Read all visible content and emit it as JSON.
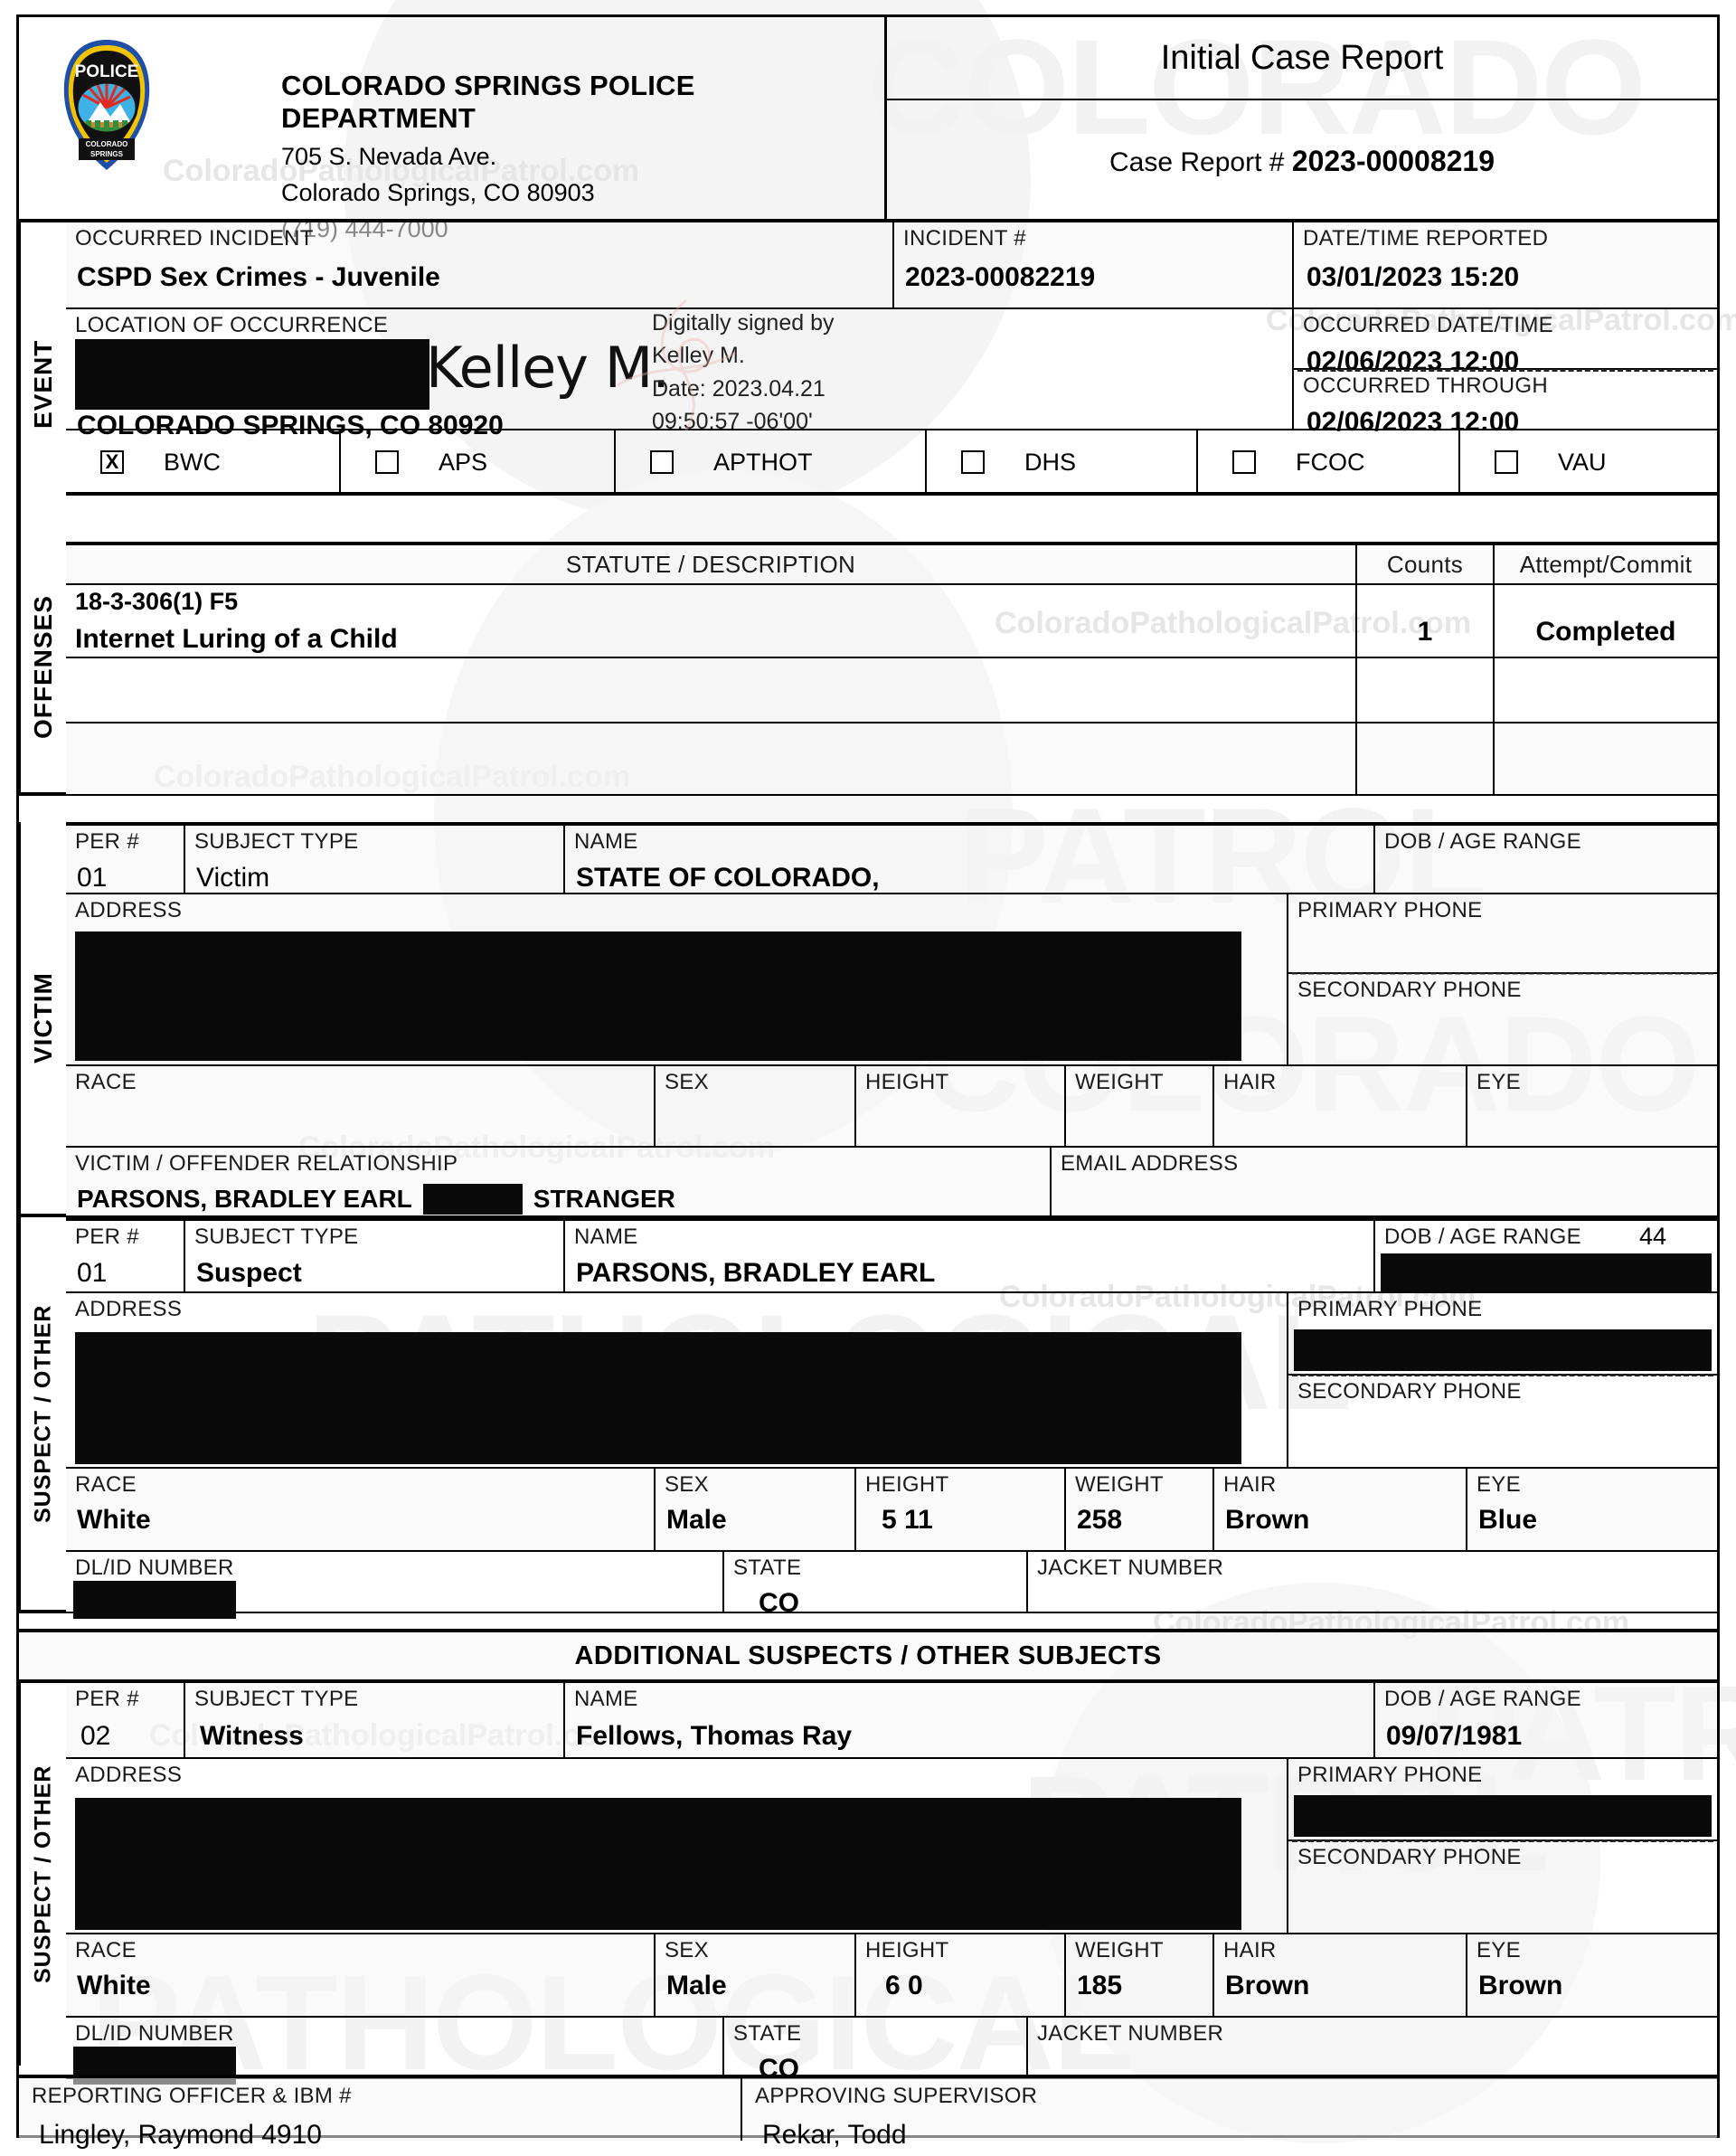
{
  "document": {
    "title": "Initial Case Report",
    "case_report_label": "Case Report #",
    "case_report_number": "2023-00008219"
  },
  "agency": {
    "name": "COLORADO SPRINGS POLICE DEPARTMENT",
    "address_street": "705 S. Nevada Ave.",
    "address_city": "Colorado Springs, CO 80903",
    "phone": "(719) 444-7000",
    "badge_word_top": "POLICE",
    "badge_word_bottom_1": "COLORADO",
    "badge_word_bottom_2": "SPRINGS"
  },
  "event": {
    "section_label": "EVENT",
    "occurred_incident_label": "OCCURRED INCIDENT",
    "occurred_incident_value": "CSPD Sex Crimes - Juvenile",
    "incident_number_label": "INCIDENT #",
    "incident_number_value": "2023-00082219",
    "datetime_reported_label": "DATE/TIME REPORTED",
    "datetime_reported_value": "03/01/2023  15:20",
    "location_label": "LOCATION OF OCCURRENCE",
    "location_redacted": true,
    "location_city": "COLORADO SPRINGS, CO 80920",
    "occurred_datetime_label": "OCCURRED DATE/TIME",
    "occurred_datetime_value": "02/06/2023  12:00",
    "occurred_through_label": "OCCURRED THROUGH",
    "occurred_through_value": "02/06/2023  12:00"
  },
  "signature": {
    "name": "Kelley M.",
    "signed_by_line1": "Digitally signed by",
    "signed_by_line2": "Kelley M.",
    "date_line": "Date: 2023.04.21",
    "time_line": "09:50:57 -06'00'"
  },
  "checkboxes": [
    {
      "label": "BWC",
      "checked": true,
      "mark": "X"
    },
    {
      "label": "APS",
      "checked": false,
      "mark": ""
    },
    {
      "label": "APTHOT",
      "checked": false,
      "mark": ""
    },
    {
      "label": "DHS",
      "checked": false,
      "mark": ""
    },
    {
      "label": "FCOC",
      "checked": false,
      "mark": ""
    },
    {
      "label": "VAU",
      "checked": false,
      "mark": ""
    }
  ],
  "offenses": {
    "section_label": "OFFENSES",
    "col_statute": "STATUTE / DESCRIPTION",
    "col_counts": "Counts",
    "col_attempt": "Attempt/Commit",
    "rows": [
      {
        "statute": "18-3-306(1) F5",
        "description": "Internet Luring of a Child",
        "counts": "1",
        "attempt_commit": "Completed"
      },
      {
        "statute": "",
        "description": "",
        "counts": "",
        "attempt_commit": ""
      },
      {
        "statute": "",
        "description": "",
        "counts": "",
        "attempt_commit": ""
      }
    ]
  },
  "victim": {
    "section_label": "VICTIM",
    "per_label": "PER #",
    "per_value": "01",
    "subject_type_label": "SUBJECT TYPE",
    "subject_type_value": "Victim",
    "name_label": "NAME",
    "name_value": "STATE OF COLORADO,",
    "dob_label": "DOB / AGE RANGE",
    "dob_value": "",
    "address_label": "ADDRESS",
    "address_redacted": true,
    "primary_phone_label": "PRIMARY PHONE",
    "primary_phone_value": "",
    "secondary_phone_label": "SECONDARY PHONE",
    "secondary_phone_value": "",
    "race_label": "RACE",
    "race_value": "",
    "sex_label": "SEX",
    "sex_value": "",
    "height_label": "HEIGHT",
    "height_value": "",
    "weight_label": "WEIGHT",
    "weight_value": "",
    "hair_label": "HAIR",
    "hair_value": "",
    "eye_label": "EYE",
    "eye_value": "",
    "relationship_label": "VICTIM / OFFENDER RELATIONSHIP",
    "relationship_name": "PARSONS, BRADLEY EARL",
    "relationship_type": "STRANGER",
    "email_label": "EMAIL ADDRESS",
    "email_value": ""
  },
  "suspect": {
    "section_label": "SUSPECT / OTHER",
    "per_label": "PER #",
    "per_value": "01",
    "subject_type_label": "SUBJECT TYPE",
    "subject_type_value": "Suspect",
    "name_label": "NAME",
    "name_value": "PARSONS, BRADLEY EARL",
    "dob_label": "DOB / AGE RANGE",
    "dob_age": "44",
    "dob_redacted": true,
    "address_label": "ADDRESS",
    "address_redacted": true,
    "primary_phone_label": "PRIMARY PHONE",
    "primary_phone_redacted": true,
    "secondary_phone_label": "SECONDARY PHONE",
    "race_label": "RACE",
    "race_value": "White",
    "sex_label": "SEX",
    "sex_value": "Male",
    "height_label": "HEIGHT",
    "height_value": "5 11",
    "weight_label": "WEIGHT",
    "weight_value": "258",
    "hair_label": "HAIR",
    "hair_value": "Brown",
    "eye_label": "EYE",
    "eye_value": "Blue",
    "dl_label": "DL/ID NUMBER",
    "dl_redacted": true,
    "state_label": "STATE",
    "state_value": "CO",
    "jacket_label": "JACKET NUMBER",
    "jacket_value": ""
  },
  "additional": {
    "banner": "ADDITIONAL SUSPECTS / OTHER SUBJECTS",
    "section_label": "SUSPECT / OTHER",
    "per_label": "PER #",
    "per_value": "02",
    "subject_type_label": "SUBJECT TYPE",
    "subject_type_value": "Witness",
    "name_label": "NAME",
    "name_value": "Fellows, Thomas Ray",
    "dob_label": "DOB / AGE RANGE",
    "dob_value": "09/07/1981",
    "address_label": "ADDRESS",
    "address_redacted": true,
    "primary_phone_label": "PRIMARY PHONE",
    "primary_phone_redacted": true,
    "secondary_phone_label": "SECONDARY PHONE",
    "race_label": "RACE",
    "race_value": "White",
    "sex_label": "SEX",
    "sex_value": "Male",
    "height_label": "HEIGHT",
    "height_value": "6 0",
    "weight_label": "WEIGHT",
    "weight_value": "185",
    "hair_label": "HAIR",
    "hair_value": "Brown",
    "eye_label": "EYE",
    "eye_value": "Brown",
    "dl_label": "DL/ID NUMBER",
    "dl_redacted": true,
    "state_label": "STATE",
    "state_value": "CO",
    "jacket_label": "JACKET NUMBER",
    "jacket_value": ""
  },
  "footer": {
    "reporting_officer_label": "REPORTING OFFICER & IBM #",
    "reporting_officer_value": "Lingley, Raymond 4910",
    "approving_supervisor_label": "APPROVING SUPERVISOR",
    "approving_supervisor_value": "Rekar, Todd"
  },
  "watermarks": {
    "url": "ColoradoPathologicalPatrol.com",
    "word_colorado": "COLORADO",
    "word_patrol": "PATROL",
    "word_pathological": "PATHOLOGICAL"
  },
  "colors": {
    "ink": "#000000",
    "redaction": "#0a0a0a",
    "watermark": "#e9e9e9",
    "badge_blue": "#1f4fa8",
    "badge_yellow": "#f2c400",
    "badge_sky": "#3eb1e5",
    "badge_red": "#e02b20",
    "badge_green": "#2f8f3e"
  }
}
